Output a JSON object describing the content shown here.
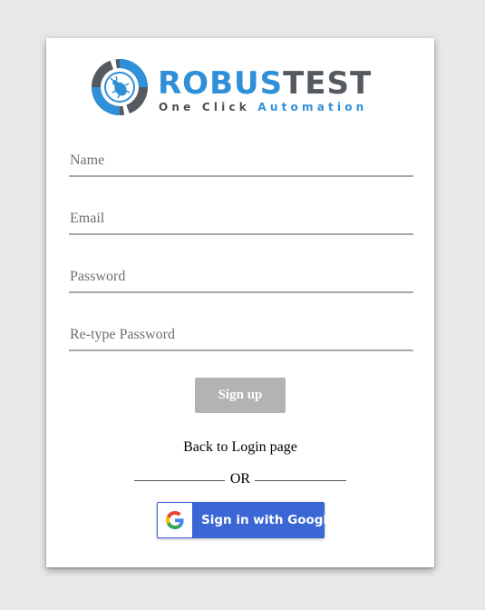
{
  "logo": {
    "word_part1": "ROBUS",
    "word_part2": "TEST",
    "tagline_part1": "One Click ",
    "tagline_part2": "Automation"
  },
  "form": {
    "name_placeholder": "Name",
    "email_placeholder": "Email",
    "password_placeholder": "Password",
    "retype_password_placeholder": "Re-type Password",
    "signup_label": "Sign up",
    "back_to_login_label": "Back to Login page",
    "or_label": "OR",
    "google_label": "Sign in with Google"
  },
  "icons": {
    "logo_icon": "bug-gear-icon",
    "google_icon": "google-g-icon"
  },
  "colors": {
    "brand_blue": "#2f8fd8",
    "brand_gray": "#555a60",
    "google_button": "#3a66d6",
    "signup_button": "#b3b3b3"
  }
}
